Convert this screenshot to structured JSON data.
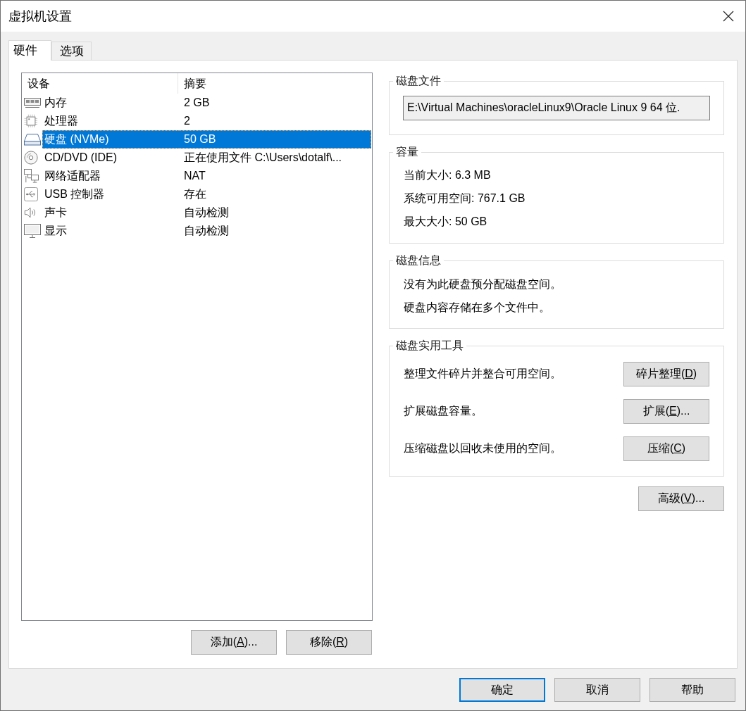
{
  "window": {
    "title": "虚拟机设置"
  },
  "tabs": [
    {
      "label": "硬件",
      "selected": true
    },
    {
      "label": "选项",
      "selected": false
    }
  ],
  "device_list": {
    "columns": [
      "设备",
      "摘要"
    ],
    "rows": [
      {
        "kind": "memory",
        "device": "内存",
        "summary": "2 GB",
        "selected": false
      },
      {
        "kind": "processor",
        "device": "处理器",
        "summary": "2",
        "selected": false
      },
      {
        "kind": "hard_disk",
        "device": "硬盘 (NVMe)",
        "summary": "50 GB",
        "selected": true
      },
      {
        "kind": "cd_dvd",
        "device": "CD/DVD (IDE)",
        "summary": "正在使用文件 C:\\Users\\dotalf\\...",
        "selected": false
      },
      {
        "kind": "network",
        "device": "网络适配器",
        "summary": "NAT",
        "selected": false
      },
      {
        "kind": "usb",
        "device": "USB 控制器",
        "summary": "存在",
        "selected": false
      },
      {
        "kind": "sound",
        "device": "声卡",
        "summary": "自动检测",
        "selected": false
      },
      {
        "kind": "display",
        "device": "显示",
        "summary": "自动检测",
        "selected": false
      }
    ]
  },
  "list_buttons": [
    {
      "before": "添加(",
      "key": "A",
      "after": ")..."
    },
    {
      "before": "移除(",
      "key": "R",
      "after": ")"
    }
  ],
  "disk_file": {
    "title": "磁盘文件",
    "path": "E:\\Virtual Machines\\oracleLinux9\\Oracle Linux 9 64 位."
  },
  "capacity": {
    "title": "容量",
    "lines": [
      "当前大小: 6.3 MB",
      "系统可用空间: 767.1 GB",
      "最大大小: 50 GB"
    ]
  },
  "disk_info": {
    "title": "磁盘信息",
    "lines": [
      "没有为此硬盘预分配磁盘空间。",
      "硬盘内容存储在多个文件中。"
    ]
  },
  "disk_utilities": {
    "title": "磁盘实用工具",
    "rows": [
      {
        "description": "整理文件碎片并整合可用空间。",
        "button": {
          "before": "碎片整理(",
          "key": "D",
          "after": ")"
        }
      },
      {
        "description": "扩展磁盘容量。",
        "button": {
          "before": "扩展(",
          "key": "E",
          "after": ")..."
        }
      },
      {
        "description": "压缩磁盘以回收未使用的空间。",
        "button": {
          "before": "压缩(",
          "key": "C",
          "after": ")"
        }
      }
    ]
  },
  "advanced_button": {
    "before": "高级(",
    "key": "V",
    "after": ")..."
  },
  "dialog_buttons": [
    {
      "label": "确定",
      "default": true
    },
    {
      "label": "取消",
      "default": false
    },
    {
      "label": "帮助",
      "default": false
    }
  ]
}
